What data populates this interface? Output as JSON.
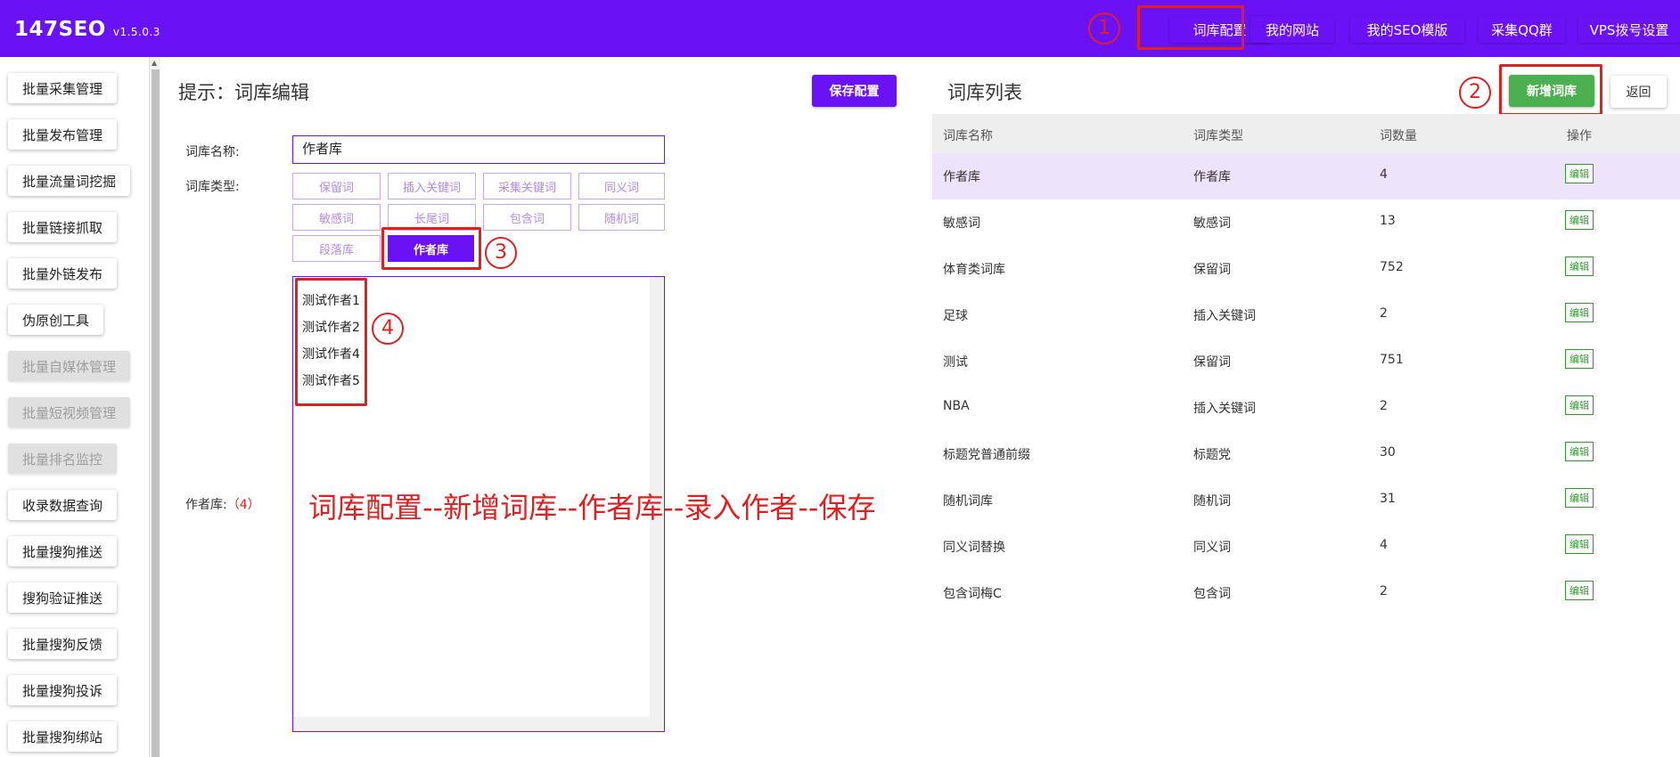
{
  "app": {
    "name": "147SEO",
    "version": "v1.5.0.3"
  },
  "topnav": [
    "词库配置",
    "我的网站",
    "我的SEO模版",
    "采集QQ群",
    "VPS拨号设置"
  ],
  "sidebar": [
    "批量采集管理",
    "批量发布管理",
    "批量流量词挖掘",
    "批量链接抓取",
    "批量外链发布",
    "伪原创工具",
    "批量自媒体管理",
    "批量短视频管理",
    "批量排名监控",
    "收录数据查询",
    "批量搜狗推送",
    "搜狗验证推送",
    "批量搜狗反馈",
    "批量搜狗投诉",
    "批量搜狗绑站"
  ],
  "editor": {
    "title": "提示：词库编辑",
    "save_label": "保存配置",
    "name_label": "词库名称:",
    "name_value": "作者库",
    "type_label": "词库类型:",
    "types": [
      "保留词",
      "插入关键词",
      "采集关键词",
      "同义词",
      "敏感词",
      "长尾词",
      "包含词",
      "随机词",
      "段落库",
      "作者库"
    ],
    "active_type": "作者库",
    "content_label": "作者库:",
    "content_count": "（4）",
    "content_lines": [
      "测试作者1",
      "测试作者2",
      "测试作者4",
      "测试作者5"
    ]
  },
  "annotations": {
    "steps": [
      "1",
      "2",
      "3",
      "4"
    ],
    "instruction": "词库配置--新增词库--作者库--录入作者--保存"
  },
  "list": {
    "title": "词库列表",
    "add_label": "新增词库",
    "back_label": "返回",
    "headers": [
      "词库名称",
      "词库类型",
      "词数量",
      "操作"
    ],
    "edit_label": "编辑",
    "rows": [
      {
        "name": "作者库",
        "type": "作者库",
        "count": "4"
      },
      {
        "name": "敏感词",
        "type": "敏感词",
        "count": "13"
      },
      {
        "name": "体育类词库",
        "type": "保留词",
        "count": "752"
      },
      {
        "name": "足球",
        "type": "插入关键词",
        "count": "2"
      },
      {
        "name": "测试",
        "type": "保留词",
        "count": "751"
      },
      {
        "name": "NBA",
        "type": "插入关键词",
        "count": "2"
      },
      {
        "name": "标题党普通前缀",
        "type": "标题党",
        "count": "30"
      },
      {
        "name": "随机词库",
        "type": "随机词",
        "count": "31"
      },
      {
        "name": "同义词替换",
        "type": "同义词",
        "count": "4"
      },
      {
        "name": "包含词梅C",
        "type": "包含词",
        "count": "2"
      }
    ]
  },
  "colors": {
    "primary": "#6a12f5",
    "success": "#4caf50",
    "annotation": "#e02020"
  }
}
